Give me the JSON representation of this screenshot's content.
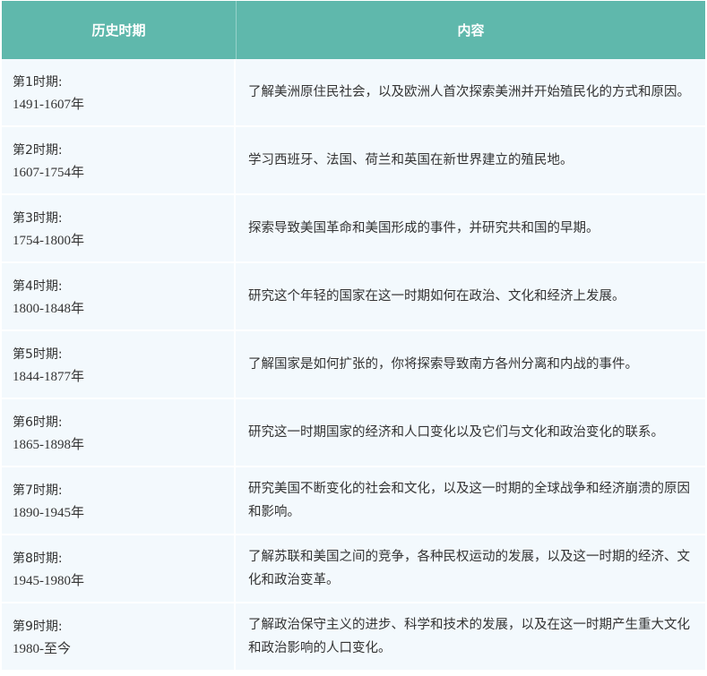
{
  "header": {
    "col1": "历史时期",
    "col2": "内容"
  },
  "rows": [
    {
      "period": "第1时期:",
      "years": "1491-1607年",
      "content": "了解美洲原住民社会，以及欧洲人首次探索美洲并开始殖民化的方式和原因。"
    },
    {
      "period": "第2时期:",
      "years": "1607-1754年",
      "content": "学习西班牙、法国、荷兰和英国在新世界建立的殖民地。"
    },
    {
      "period": "第3时期:",
      "years": "1754-1800年",
      "content": "探索导致美国革命和美国形成的事件，并研究共和国的早期。"
    },
    {
      "period": "第4时期:",
      "years": "1800-1848年",
      "content": "研究这个年轻的国家在这一时期如何在政治、文化和经济上发展。"
    },
    {
      "period": "第5时期:",
      "years": "1844-1877年",
      "content": "了解国家是如何扩张的，你将探索导致南方各州分离和内战的事件。"
    },
    {
      "period": "第6时期:",
      "years": "1865-1898年",
      "content": "研究这一时期国家的经济和人口变化以及它们与文化和政治变化的联系。"
    },
    {
      "period": "第7时期:",
      "years": "1890-1945年",
      "content": "研究美国不断变化的社会和文化，以及这一时期的全球战争和经济崩溃的原因和影响。"
    },
    {
      "period": "第8时期:",
      "years": "1945-1980年",
      "content": "了解苏联和美国之间的竞争，各种民权运动的发展，以及这一时期的经济、文化和政治变革。"
    },
    {
      "period": "第9时期:",
      "years": "1980-至今",
      "content": "了解政治保守主义的进步、科学和技术的发展，以及在这一时期产生重大文化和政治影响的人口变化。"
    }
  ]
}
